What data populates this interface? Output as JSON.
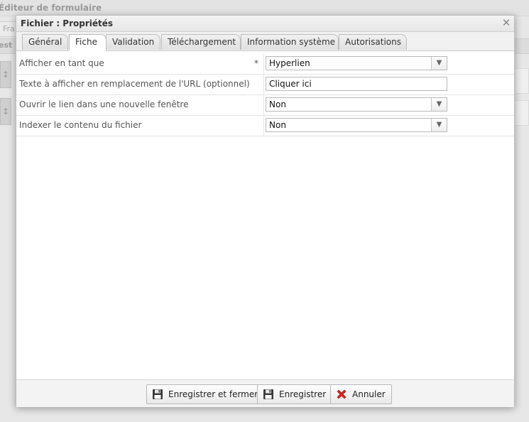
{
  "background": {
    "app_title": "Éditeur de formulaire",
    "tab_fragment": "Fra",
    "section_fragment": "est"
  },
  "dialog": {
    "title": "Fichier : Propriétés",
    "tabs": [
      {
        "label": "Général",
        "active": false
      },
      {
        "label": "Fiche",
        "active": true
      },
      {
        "label": "Validation",
        "active": false
      },
      {
        "label": "Téléchargement",
        "active": false
      },
      {
        "label": "Information système",
        "active": false
      },
      {
        "label": "Autorisations",
        "active": false
      }
    ],
    "rows": [
      {
        "label": "Afficher en tant que",
        "required_marker": "*",
        "type": "select",
        "value": "Hyperlien"
      },
      {
        "label": "Texte à afficher en remplacement de l'URL (optionnel)",
        "type": "text",
        "value": "Cliquer ici"
      },
      {
        "label": "Ouvrir le lien dans une nouvelle fenêtre",
        "type": "select",
        "value": "Non"
      },
      {
        "label": "Indexer le contenu du fichier",
        "type": "select",
        "value": "Non"
      }
    ],
    "buttons": {
      "save_close": "Enregistrer et fermer",
      "save": "Enregistrer",
      "cancel": "Annuler"
    }
  },
  "icons": {
    "close": "close-icon",
    "save_close": "floppy-disk-icon",
    "save": "floppy-disk-icon",
    "cancel": "red-cross-icon"
  },
  "colors": {
    "cancel_red": "#d9231e",
    "floppy": "#3a3a3a"
  }
}
